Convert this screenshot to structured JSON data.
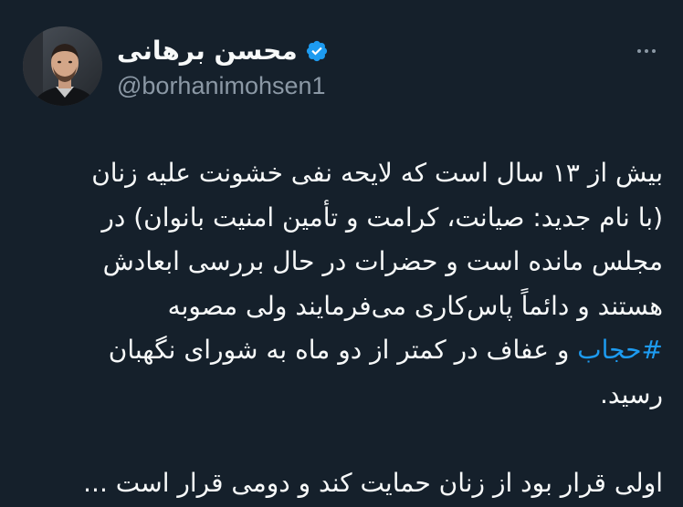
{
  "author": {
    "display_name": "محسن برهانی",
    "handle": "@borhanimohsen1",
    "verified": true,
    "avatar_icon": "avatar-photo"
  },
  "menu": {
    "icon": "more-horizontal-icon"
  },
  "tweet": {
    "line1": "بیش از ۱۳ سال است که لایحه نفی خشونت علیه زنان",
    "line2": "(با نام جدید: صیانت، کرامت و تأمین امنیت بانوان) در",
    "line3": "مجلس مانده است و حضرات در حال بررسی ابعادش",
    "line4": "هستند و دائماً پاس‌کاری می‌فرمایند ولی مصوبه",
    "hashtag": "#حجاب",
    "line5_rest": " و عفاف در کمتر از دو ماه به شورای نگهبان",
    "line6": "رسید.",
    "line7": "اولی قرار بود از زنان حمایت کند و دومی قرار است ..."
  },
  "colors": {
    "background": "#15202b",
    "text": "#f7f9f9",
    "secondary": "#8b98a5",
    "link": "#1d9bf0",
    "verified_badge": "#1d9bf0"
  }
}
